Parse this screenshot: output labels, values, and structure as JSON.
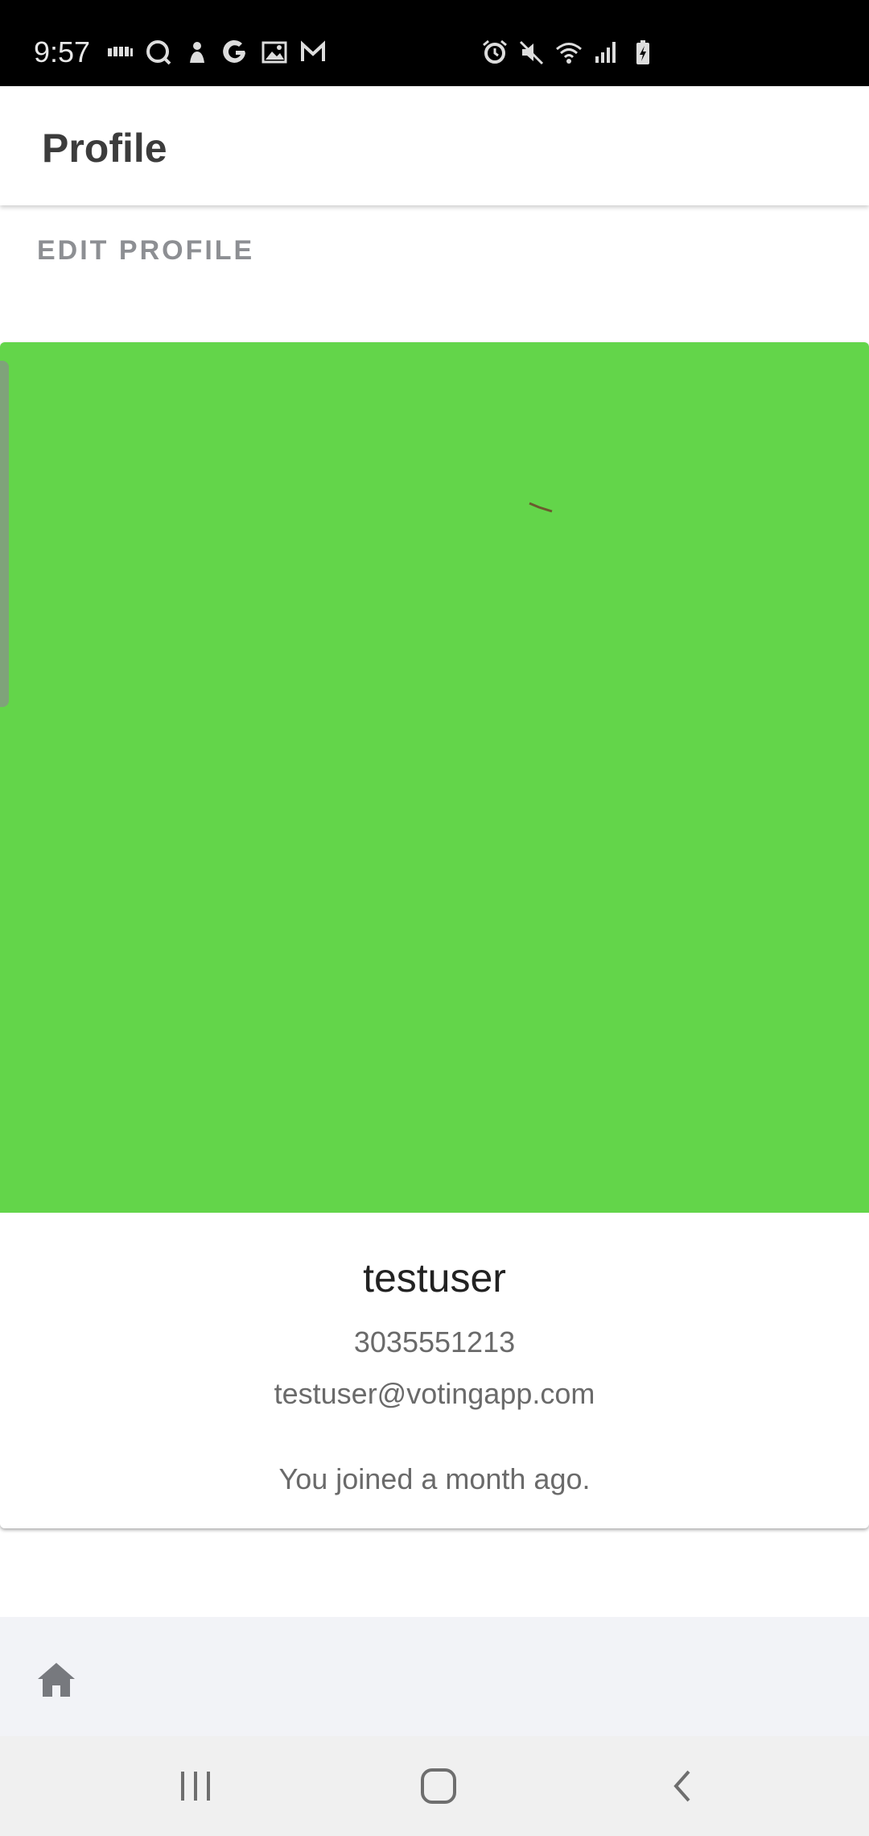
{
  "status_bar": {
    "time": "9:57",
    "left_icons": [
      "carrier-icon",
      "chat-bubble-icon",
      "notification-icon",
      "google-icon",
      "gallery-icon",
      "gmail-icon"
    ],
    "right_icons": [
      "alarm-icon",
      "mute-icon",
      "wifi-icon",
      "signal-icon",
      "battery-charging-icon"
    ]
  },
  "app_bar": {
    "title": "Profile"
  },
  "edit_profile_label": "EDIT PROFILE",
  "profile": {
    "image_color": "#63d54a",
    "username": "testuser",
    "phone": "3035551213",
    "email": "testuser@votingapp.com",
    "joined": "You joined a month ago."
  },
  "bottom_tabs": [
    {
      "icon": "home-icon"
    }
  ],
  "system_nav": {
    "buttons": [
      "recents-icon",
      "home-circle-icon",
      "back-icon"
    ]
  }
}
